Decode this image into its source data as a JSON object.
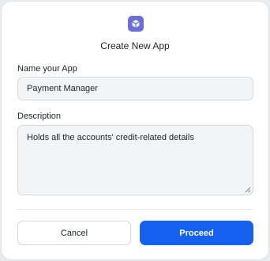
{
  "dialog": {
    "icon": "app-cube-icon",
    "title": "Create New App",
    "name_label": "Name your App",
    "name_value": "Payment Manager",
    "description_label": "Description",
    "description_value": "Holds all the accounts' credit-related details",
    "cancel_label": "Cancel",
    "proceed_label": "Proceed"
  },
  "colors": {
    "accent": "#1660f0",
    "icon_bg": "#6b6fd3",
    "field_bg": "#f3f4f6"
  }
}
